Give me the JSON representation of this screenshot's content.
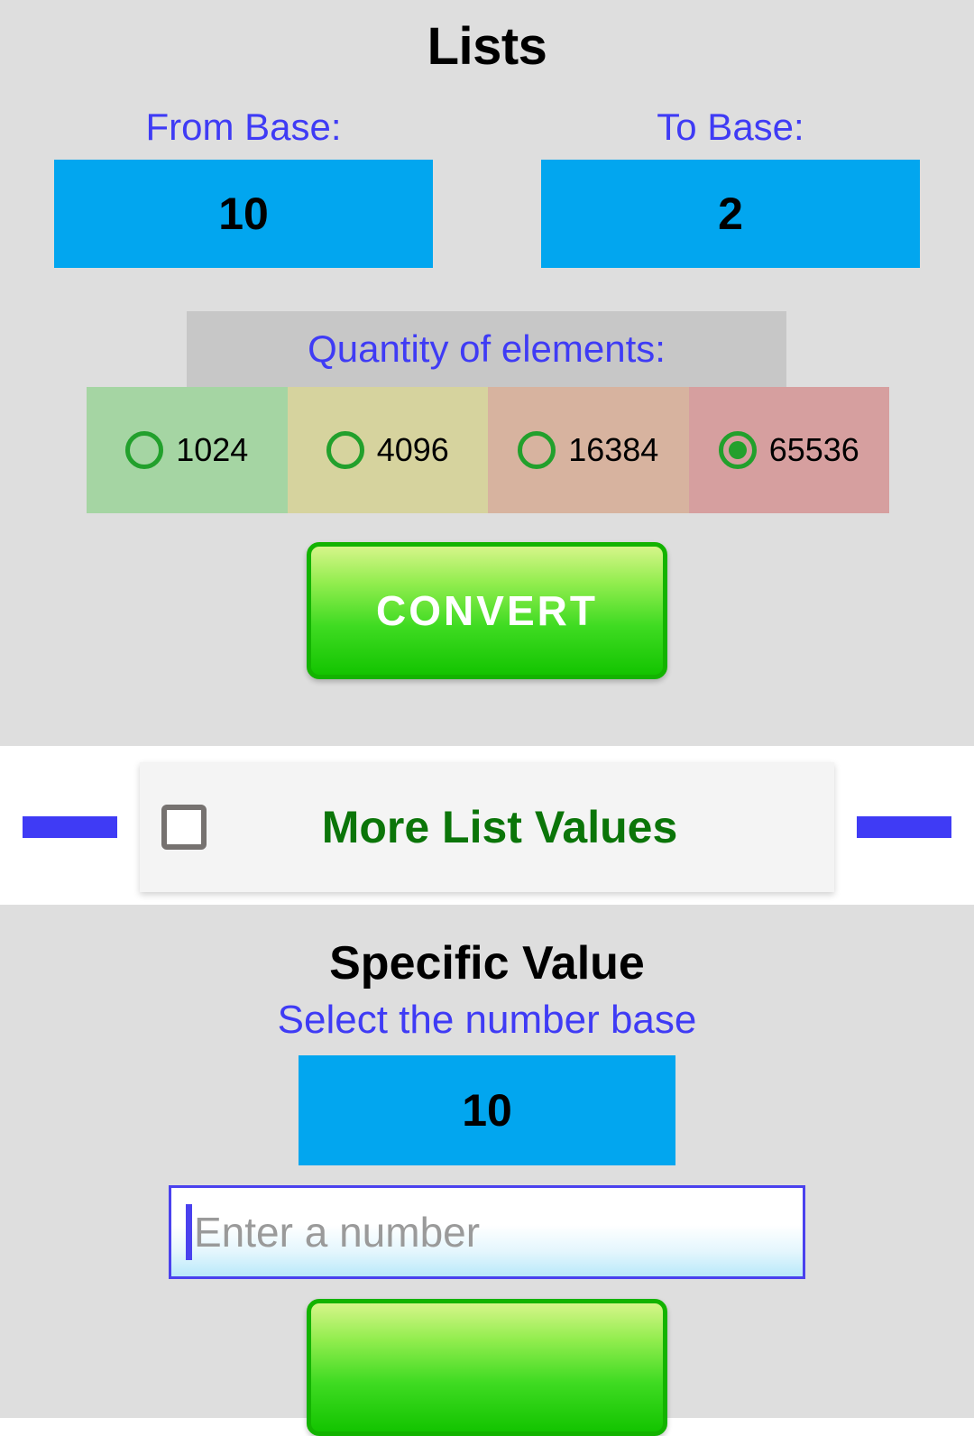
{
  "app": {
    "background_color": "#dedede",
    "accent_blue": "#3f3bf5",
    "select_blue": "#02a6ef",
    "green": "#22a02c"
  },
  "lists": {
    "title": "Lists",
    "from_base": {
      "label": "From Base:",
      "value": "10"
    },
    "to_base": {
      "label": "To Base:",
      "value": "2"
    },
    "quantity": {
      "label": "Quantity of elements:",
      "options": [
        {
          "label": "1024",
          "selected": false,
          "tile_color": "#a5d5a3"
        },
        {
          "label": "4096",
          "selected": false,
          "tile_color": "#d6d39e"
        },
        {
          "label": "16384",
          "selected": false,
          "tile_color": "#d7b39f"
        },
        {
          "label": "65536",
          "selected": true,
          "tile_color": "#d69f9f"
        }
      ]
    },
    "convert_button": "CONVERT"
  },
  "more_list_values": {
    "label": "More List Values",
    "checked": false
  },
  "specific_value": {
    "title": "Specific Value",
    "subtitle": "Select the number base",
    "base_value": "10",
    "input_placeholder": "Enter a number",
    "input_value": ""
  }
}
